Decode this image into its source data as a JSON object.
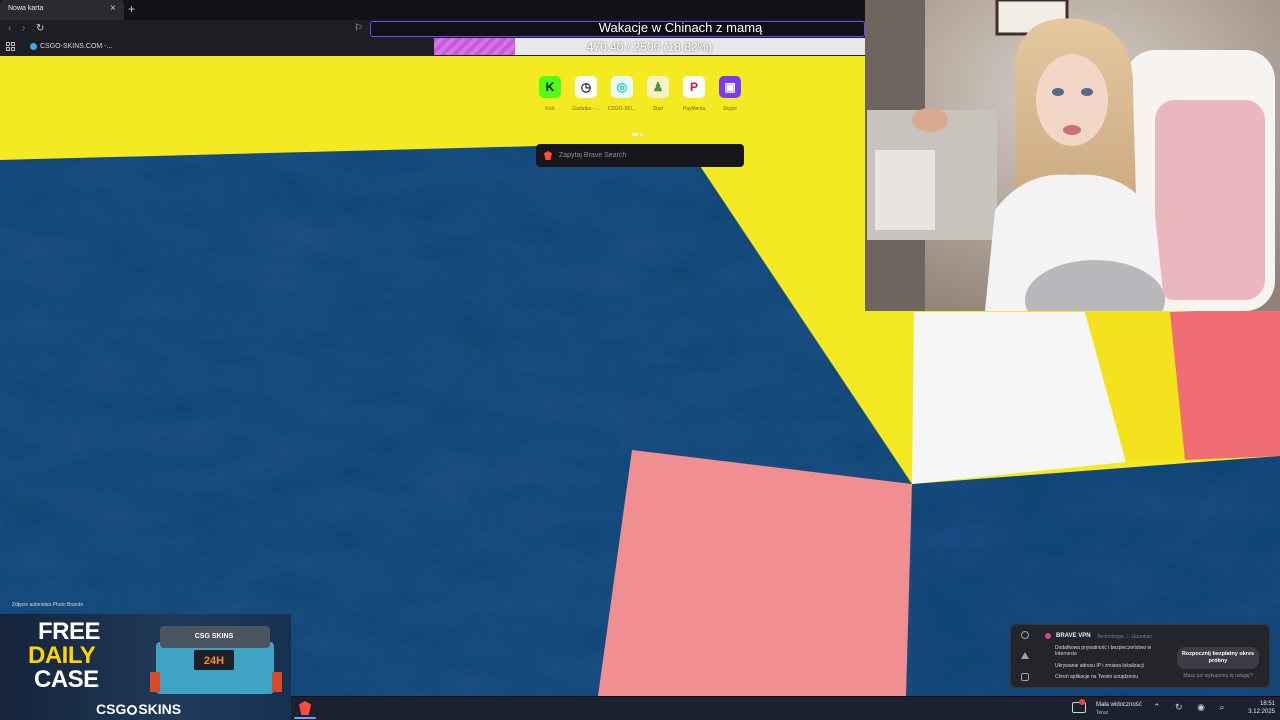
{
  "browser": {
    "tab_title": "Nowa karta",
    "tab_close": "×",
    "new_tab": "+",
    "nav_back": "‹",
    "nav_forward": "›",
    "nav_reload": "↻",
    "bookmark": "CSGO-SKINS.COM -...",
    "accent_color": "#6a4dff"
  },
  "goal": {
    "title": "Wakacje w Chinach z mamą",
    "progress_text": "470.40 / 2500 (18.82%)",
    "current": 470.4,
    "target": 2500,
    "percent": 18.82,
    "fill_color": "#c55ad8"
  },
  "speed_dials": [
    {
      "label": "Kick",
      "icon": "kick-icon",
      "glyph": "K",
      "bg": "#53fc18",
      "fg": "#0b0b0b"
    },
    {
      "label": "Gadatka - ...",
      "icon": "clock-icon",
      "glyph": "◷",
      "bg": "#ffffff",
      "fg": "#222222"
    },
    {
      "label": "CSGO-SKI...",
      "icon": "csgo-skins-icon",
      "glyph": "◎",
      "bg": "#e8f8f7",
      "fg": "#27c7c0"
    },
    {
      "label": "Start",
      "icon": "user-icon",
      "glyph": "♟",
      "bg": "#f6f2c8",
      "fg": "#4a9a3a"
    },
    {
      "label": "PayMenta",
      "icon": "paypal-icon",
      "glyph": "P",
      "bg": "#ffffff",
      "fg": "#d8162a"
    },
    {
      "label": "Skype",
      "icon": "window-icon",
      "glyph": "▣",
      "bg": "#7a3cf0",
      "fg": "#ffffff"
    }
  ],
  "search": {
    "placeholder": "Zapytaj Brave Search"
  },
  "photo_credit": "Zdjęcie autorstwa Photo Brands",
  "ad": {
    "line1": "FREE",
    "line2": "DAILY",
    "line3": "CASE",
    "brand_left": "CSG",
    "brand_right": "SKINS",
    "badge": "24H",
    "case_label": "CSG SKINS"
  },
  "vpn_popup": {
    "title": "BRAVE VPN",
    "subtitle": "Technologia ⓘ Guardian",
    "items": [
      "Dodatkowa prywatność i bezpieczeństwo w Internecie",
      "Ukrywanie adresu IP i zmiana lokalizacji",
      "Chroń aplikacje na Twoim urządzeniu"
    ],
    "cta": "Rozpocznij bezpłatny okres próbny",
    "link": "Masz już wykupioną tę usługę?"
  },
  "taskbar": {
    "notification_title": "Mała widoczność",
    "notification_sub": "Teraz",
    "tray_icons": "⌃ ↻ ◉ ⌕",
    "time": "18:51",
    "date": "3.12.2025"
  }
}
